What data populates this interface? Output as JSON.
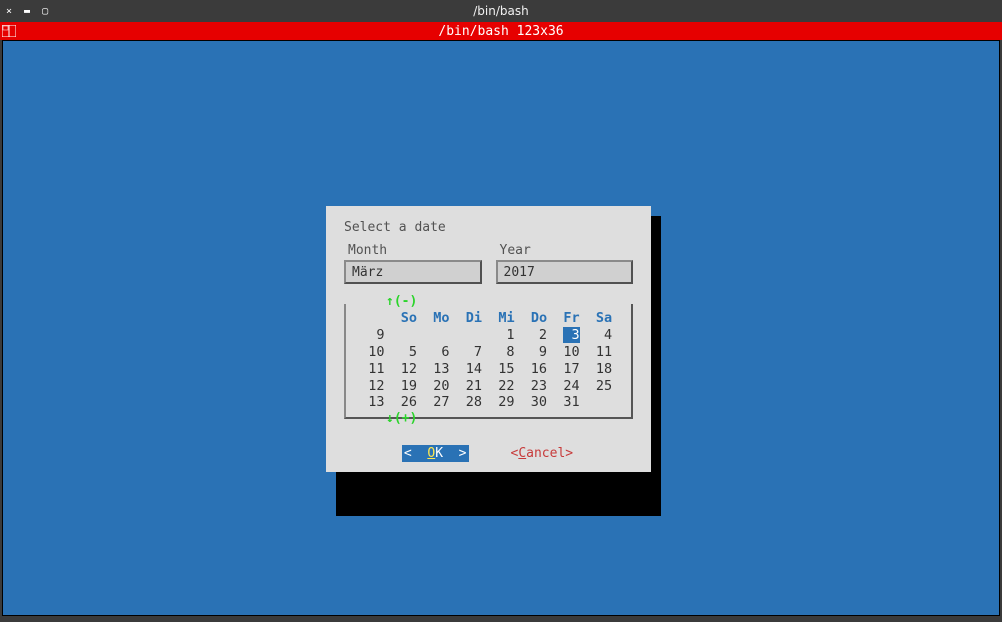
{
  "window": {
    "title": "/bin/bash",
    "controls": {
      "close": "×",
      "minimize": "▬",
      "maximize": "▢"
    }
  },
  "redbar": {
    "title": "/bin/bash 123x36"
  },
  "dialog": {
    "title": "Select a date",
    "month_label": "Month",
    "year_label": "Year",
    "month_value": "März",
    "year_value": "2017",
    "hint_up": "↑(-)",
    "hint_down": "↓(+)",
    "ok_label": "O",
    "ok_rest": "K",
    "ok_lt": "<",
    "ok_gt": ">",
    "cancel_open": "<",
    "cancel_hot": "C",
    "cancel_rest": "ancel",
    "cancel_close": ">"
  },
  "calendar": {
    "headers": [
      "So",
      "Mo",
      "Di",
      "Mi",
      "Do",
      "Fr",
      "Sa"
    ],
    "week_col": [
      "",
      "9",
      "10",
      "11",
      "12",
      "13"
    ],
    "rows": [
      [
        "",
        "",
        "",
        "",
        "1",
        "2",
        "3",
        "4"
      ],
      [
        "",
        "5",
        "6",
        "7",
        "8",
        "9",
        "10",
        "11"
      ],
      [
        "",
        "12",
        "13",
        "14",
        "15",
        "16",
        "17",
        "18"
      ],
      [
        "",
        "19",
        "20",
        "21",
        "22",
        "23",
        "24",
        "25"
      ],
      [
        "",
        "26",
        "27",
        "28",
        "29",
        "30",
        "31",
        ""
      ]
    ],
    "selected": "3"
  }
}
